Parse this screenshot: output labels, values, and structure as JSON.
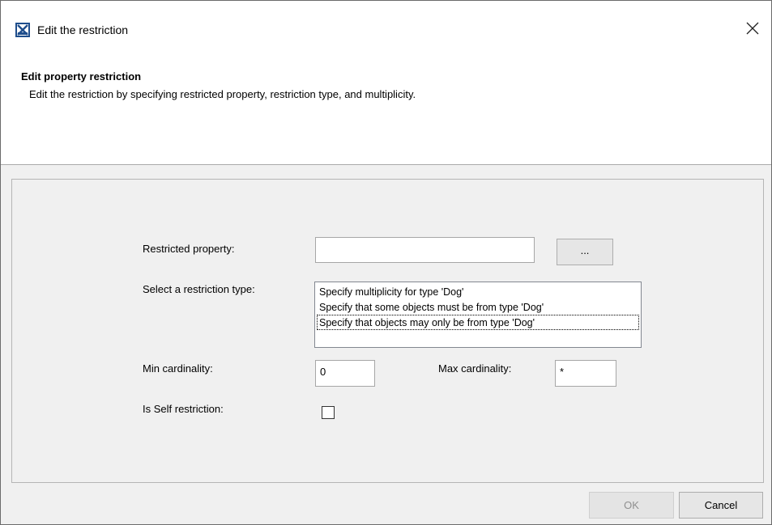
{
  "window": {
    "title": "Edit the restriction",
    "close_glyph": "✕"
  },
  "header": {
    "title": "Edit property restriction",
    "description": "Edit the restriction by specifying restricted property, restriction type, and multiplicity."
  },
  "form": {
    "restricted_property_label": "Restricted property:",
    "restricted_property_value": "",
    "browse_button_label": "...",
    "restriction_type_label": "Select a restriction type:",
    "restriction_types": [
      "Specify multiplicity for type 'Dog'",
      "Specify that some objects must be from type 'Dog'",
      "Specify that objects may only be from type 'Dog'"
    ],
    "min_cardinality_label": "Min cardinality:",
    "min_cardinality_value": "0",
    "max_cardinality_label": "Max cardinality:",
    "max_cardinality_value": "*",
    "is_self_label": "Is Self restriction:",
    "is_self_checked": false
  },
  "footer": {
    "ok_label": "OK",
    "cancel_label": "Cancel"
  },
  "icons": {
    "app": "magicdraw-app-icon",
    "close": "close-icon"
  },
  "colors": {
    "window_bg": "#f0f0f0",
    "header_bg": "#ffffff",
    "app_icon_blue": "#1f4e8c"
  }
}
